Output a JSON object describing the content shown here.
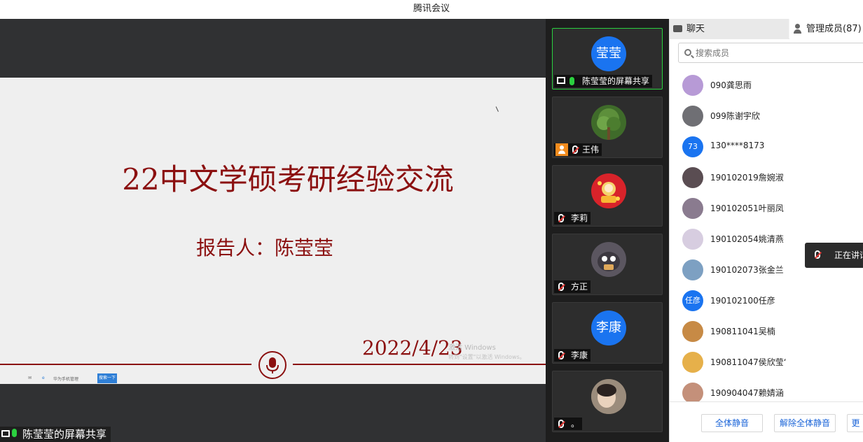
{
  "window": {
    "title": "腾讯会议"
  },
  "slide": {
    "title": "22中文学硕考研经验交流",
    "reporter": "报告人：陈莹莹",
    "date": "2022/4/23",
    "watermark_line1": "激活 Windows",
    "watermark_line2": "转到\"设置\"以激活 Windows。",
    "taskbar_item": "华为手机管理",
    "taskbar_button": "搜索一下"
  },
  "share_label": "陈莹莹的屏幕共享",
  "video_tiles": [
    {
      "name": "陈莹莹的屏幕共享",
      "avatar_text": "莹莹",
      "avatar_color": "#1a74f0",
      "active": true,
      "mic": "on"
    },
    {
      "name": "王伟",
      "avatar_text": "",
      "avatar_color": "#3f6b2a",
      "mic": "muted"
    },
    {
      "name": "李莉",
      "avatar_text": "",
      "avatar_color": "#d8232a",
      "mic": "muted"
    },
    {
      "name": "方正",
      "avatar_text": "",
      "avatar_color": "#5b5660",
      "mic": "muted"
    },
    {
      "name": "李康",
      "avatar_text": "李康",
      "avatar_color": "#1a74f0",
      "mic": "muted"
    },
    {
      "name": "。",
      "avatar_text": "",
      "avatar_color": "#7a6a5a",
      "mic": "muted"
    }
  ],
  "panel": {
    "tab_chat": "聊天",
    "tab_members": "管理成员(87)",
    "search_placeholder": "搜索成员",
    "members": [
      {
        "name": "090龚思雨",
        "avatar_text": "",
        "avatar_color": "#b79ad6"
      },
      {
        "name": "099陈谢宇欣",
        "avatar_text": "",
        "avatar_color": "#6f6f74"
      },
      {
        "name": "130****8173",
        "avatar_text": "73",
        "avatar_color": "#1a74f0"
      },
      {
        "name": "190102019詹婉淑",
        "avatar_text": "",
        "avatar_color": "#5a4d52"
      },
      {
        "name": "190102051叶丽凤",
        "avatar_text": "",
        "avatar_color": "#8a7b8f"
      },
      {
        "name": "190102054姚清燕",
        "avatar_text": "",
        "avatar_color": "#d7cde0"
      },
      {
        "name": "190102073张金兰",
        "avatar_text": "",
        "avatar_color": "#7da0c2"
      },
      {
        "name": "190102100任彦",
        "avatar_text": "任彦",
        "avatar_color": "#1a74f0"
      },
      {
        "name": "190811041吴楠",
        "avatar_text": "",
        "avatar_color": "#c78a45"
      },
      {
        "name": "190811047侯欣莹‘",
        "avatar_text": "",
        "avatar_color": "#e6b04a"
      },
      {
        "name": "190904047赖婧涵",
        "avatar_text": "",
        "avatar_color": "#c4907a"
      }
    ],
    "mute_all": "全体静音",
    "unmute_all": "解除全体静音",
    "more": "更"
  },
  "toast": "正在讲话"
}
